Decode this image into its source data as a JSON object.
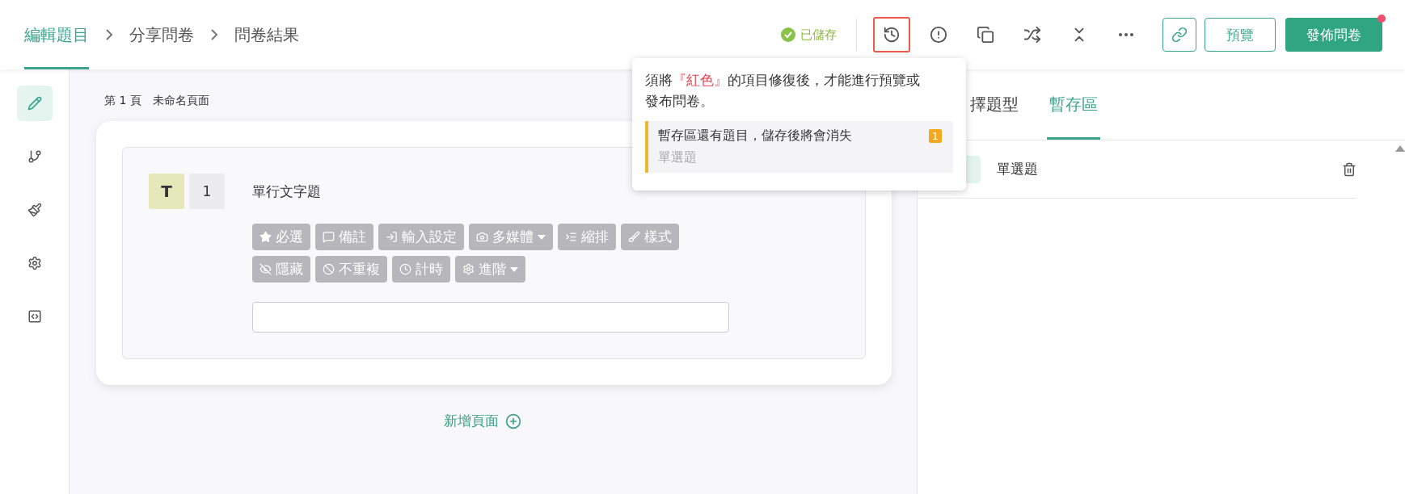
{
  "breadcrumb": [
    {
      "label": "編輯題目",
      "selected": true
    },
    {
      "label": "分享問卷",
      "selected": false
    },
    {
      "label": "問卷結果",
      "selected": false
    }
  ],
  "save_status": "已儲存",
  "toolbar": [
    {
      "kind": "history",
      "selected": true
    },
    {
      "kind": "alert",
      "selected": false
    },
    {
      "kind": "copy",
      "selected": false
    },
    {
      "kind": "shuffle",
      "selected": false
    },
    {
      "kind": "collapse",
      "selected": false
    },
    {
      "kind": "more",
      "selected": false
    }
  ],
  "link_button": {
    "kind": "link"
  },
  "preview_button": "預覽",
  "publish_button": {
    "label": "發佈問卷",
    "notification": true
  },
  "sidebar": [
    {
      "kind": "edit",
      "selected": true
    },
    {
      "kind": "branch",
      "selected": false
    },
    {
      "kind": "paint",
      "selected": false
    },
    {
      "kind": "settings",
      "selected": false
    },
    {
      "kind": "code",
      "selected": false
    }
  ],
  "page": {
    "number_label": "第 1 頁",
    "name": "未命名頁面"
  },
  "question": {
    "type_badge": "T",
    "number": "1",
    "title": "單行文字題",
    "options": [
      {
        "kind": "star",
        "label": "必選",
        "dropdown": false
      },
      {
        "kind": "note",
        "label": "備註",
        "dropdown": false
      },
      {
        "kind": "input",
        "label": "輸入設定",
        "dropdown": false
      },
      {
        "kind": "camera",
        "label": "多媒體",
        "dropdown": true
      },
      {
        "kind": "indent",
        "label": "縮排",
        "dropdown": false
      },
      {
        "kind": "brush",
        "label": "樣式",
        "dropdown": false
      },
      {
        "kind": "hide",
        "label": "隱藏",
        "dropdown": false
      },
      {
        "kind": "ban",
        "label": "不重複",
        "dropdown": false
      },
      {
        "kind": "clock",
        "label": "計時",
        "dropdown": false
      },
      {
        "kind": "gear",
        "label": "進階",
        "dropdown": true
      }
    ]
  },
  "add_page": "新增頁面",
  "right_panel": {
    "tabs": [
      {
        "label": "擇題型",
        "selected": false
      },
      {
        "label": "暫存區",
        "selected": true
      }
    ],
    "items": [
      {
        "label": "單選題"
      }
    ]
  },
  "popover": {
    "message_before": "須將",
    "message_highlight": "『紅色』",
    "message_after": "的項目修復後，才能進行預覽或發布問卷。",
    "notice": {
      "text": "暫存區還有題目，儲存後將會消失",
      "count": "1",
      "item": "單選題"
    }
  }
}
